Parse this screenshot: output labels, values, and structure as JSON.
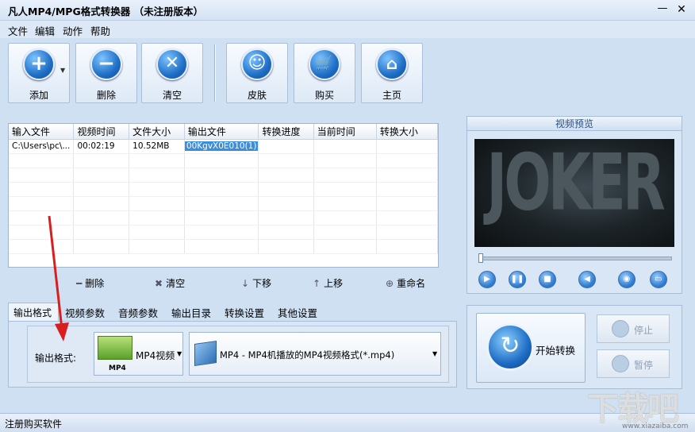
{
  "window": {
    "title": "凡人MP4/MPG格式转换器 （未注册版本）",
    "min_glyph": "—",
    "close_glyph": "✕"
  },
  "menu": [
    "文件",
    "编辑",
    "动作",
    "帮助"
  ],
  "toolbar": {
    "add": "添加",
    "delete": "删除",
    "clear": "清空",
    "skin": "皮肤",
    "buy": "购买",
    "home": "主页"
  },
  "file_table": {
    "columns": [
      "输入文件",
      "视频时间",
      "文件大小",
      "输出文件",
      "转换进度",
      "当前时间",
      "转换大小"
    ],
    "rows": [
      {
        "input": "C:\\Users\\pc\\...",
        "duration": "00:02:19",
        "size": "10.52MB",
        "output": "00KgvX0E010(1)",
        "progress": "",
        "current": "",
        "converted": ""
      }
    ]
  },
  "list_actions": {
    "delete": "删除",
    "clear": "清空",
    "down": "下移",
    "up": "上移",
    "rename": "重命名"
  },
  "preview": {
    "title": "视频预览",
    "video_text": "JOKER"
  },
  "tabs": [
    "输出格式",
    "视频参数",
    "音频参数",
    "输出目录",
    "转换设置",
    "其他设置"
  ],
  "output": {
    "label": "输出格式:",
    "format_name": "MP4视频",
    "format_icon_text": "MP4",
    "profile": "MP4 - MP4机播放的MP4视频格式(*.mp4)"
  },
  "convert": {
    "start": "开始转换",
    "stop": "停止",
    "pause": "暂停"
  },
  "status": {
    "text": "注册购买软件"
  },
  "watermark": {
    "main": "下载吧",
    "sub": "www.xiazaiba.com"
  },
  "colors": {
    "accent": "#1f6fc6",
    "annotation": "#d81e1e",
    "selection": "#3c8ddb"
  }
}
